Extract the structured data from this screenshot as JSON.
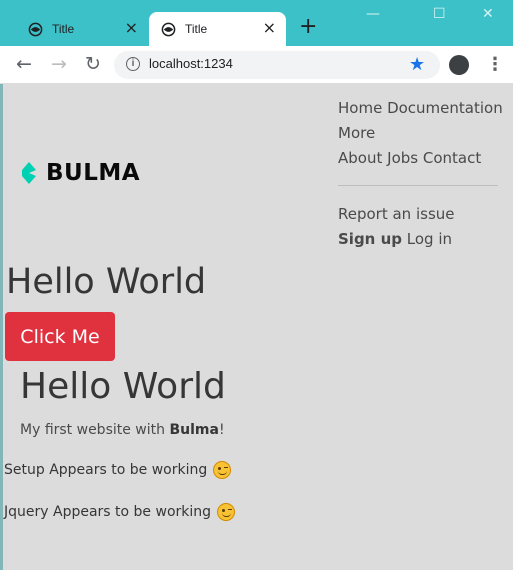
{
  "browser": {
    "tabs": [
      {
        "title": "Title",
        "icon": "globe-icon"
      },
      {
        "title": "Title",
        "icon": "globe-icon"
      }
    ],
    "new_tab": "+",
    "close_glyph": "×",
    "url": "localhost:1234",
    "window_controls": [
      "—",
      "☐",
      "✕"
    ]
  },
  "navbar": {
    "brand": "BULMA",
    "brand_color": "#00d1b2",
    "links": [
      "Home",
      "Documentation",
      "More",
      "About",
      "Jobs",
      "Contact"
    ],
    "report": "Report an issue",
    "signup": "Sign up",
    "login": "Log in"
  },
  "content": {
    "heading1": "Hello World",
    "button_label": "Click Me",
    "button_color": "#e0313f",
    "heading2": "Hello World",
    "subtitle_prefix": "My first website with ",
    "subtitle_bold": "Bulma",
    "subtitle_suffix": "!",
    "status1": "Setup Appears to be working",
    "status2": "Jquery Appears to be working"
  }
}
